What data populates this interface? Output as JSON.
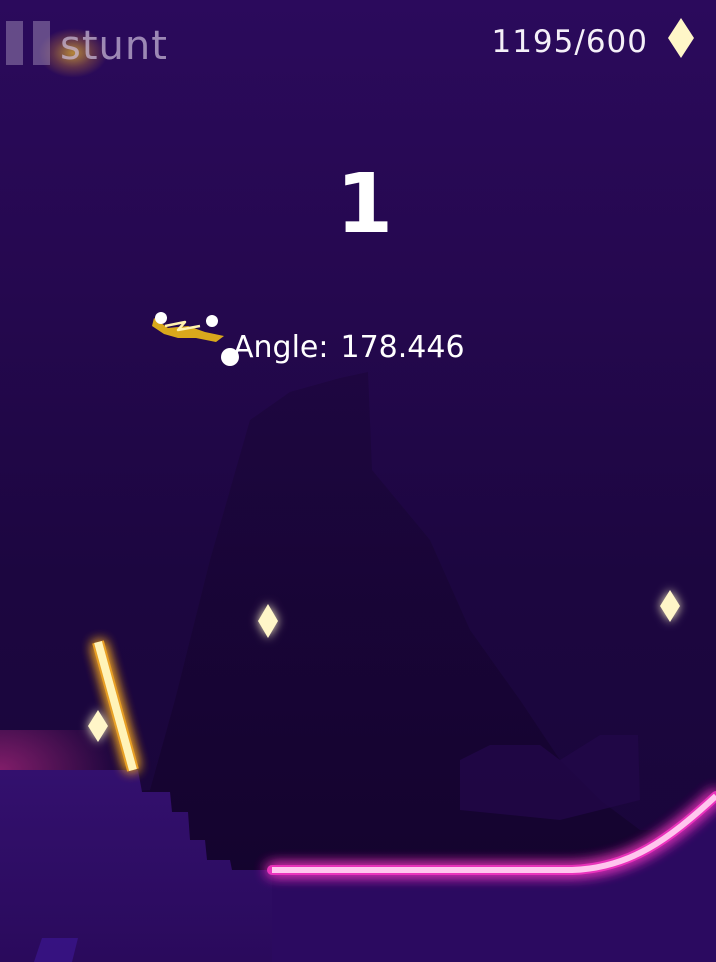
{
  "hud": {
    "mode_label": "stunt",
    "score_text": "1195/600",
    "combo_count": "1"
  },
  "debug": {
    "angle_label": "Angle:",
    "angle_value": "178.446"
  },
  "icons": {
    "pause": "pause-icon",
    "gem": "diamond-gem-icon",
    "player": "hoverboard-rider"
  },
  "colors": {
    "background_top": "#2b0a5c",
    "background_bottom": "#190539",
    "ground": "#2c0a63",
    "neon_track": "#ff9ee0",
    "neon_track_glow": "#ff38c8",
    "neon_post": "#fff3b8",
    "gem": "#fff6c8",
    "gem_glow": "#ffb020",
    "board": "#d9a81c"
  }
}
